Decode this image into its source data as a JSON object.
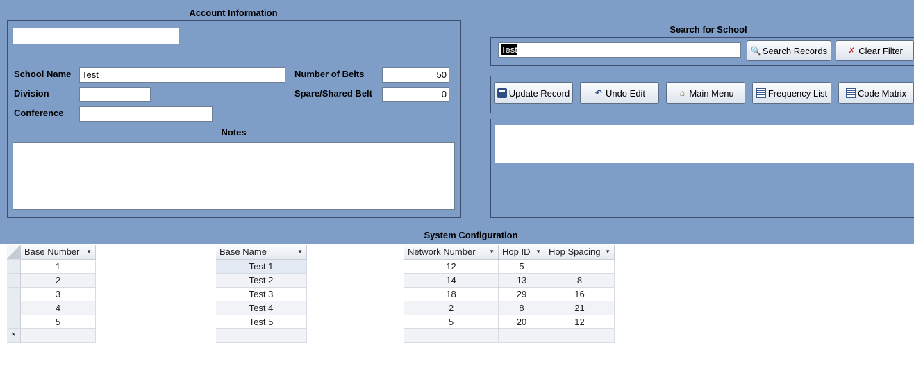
{
  "account": {
    "title": "Account Information",
    "account_field": "",
    "school_name_label": "School Name",
    "school_name": "Test",
    "division_label": "Division",
    "division": "",
    "conference_label": "Conference",
    "conference": "",
    "notes_label": "Notes",
    "notes": "",
    "belts_label": "Number of Belts",
    "belts": "50",
    "spare_label": "Spare/Shared Belt",
    "spare": "0"
  },
  "search": {
    "title": "Search for School",
    "value": "Test",
    "search_button": "Search Records",
    "clear_button": "Clear Filter"
  },
  "actions": {
    "update": "Update Record",
    "undo": "Undo Edit",
    "main_menu": "Main Menu",
    "frequency": "Frequency List",
    "code_matrix": "Code Matrix"
  },
  "system": {
    "title": "System Configuration",
    "columns": [
      "Base Number",
      "Base Name",
      "Network Number",
      "Hop ID",
      "Hop Spacing"
    ],
    "rows": [
      {
        "base_number": "1",
        "base_name": "Test 1",
        "network_number": "12",
        "hop_id": "5",
        "hop_spacing": ""
      },
      {
        "base_number": "2",
        "base_name": "Test 2",
        "network_number": "14",
        "hop_id": "13",
        "hop_spacing": "8"
      },
      {
        "base_number": "3",
        "base_name": "Test 3",
        "network_number": "18",
        "hop_id": "29",
        "hop_spacing": "16"
      },
      {
        "base_number": "4",
        "base_name": "Test 4",
        "network_number": "2",
        "hop_id": "8",
        "hop_spacing": "21"
      },
      {
        "base_number": "5",
        "base_name": "Test 5",
        "network_number": "5",
        "hop_id": "20",
        "hop_spacing": "12"
      }
    ],
    "new_row_marker": "*"
  },
  "icons": {
    "search": "binoculars-icon",
    "clear": "filter-clear-icon",
    "update": "save-icon",
    "undo": "undo-icon",
    "main_menu": "home-icon",
    "frequency": "list-icon",
    "code_matrix": "list-icon"
  },
  "colors": {
    "form_background": "#7f9ec7",
    "frame_border": "#3c4e6c"
  }
}
